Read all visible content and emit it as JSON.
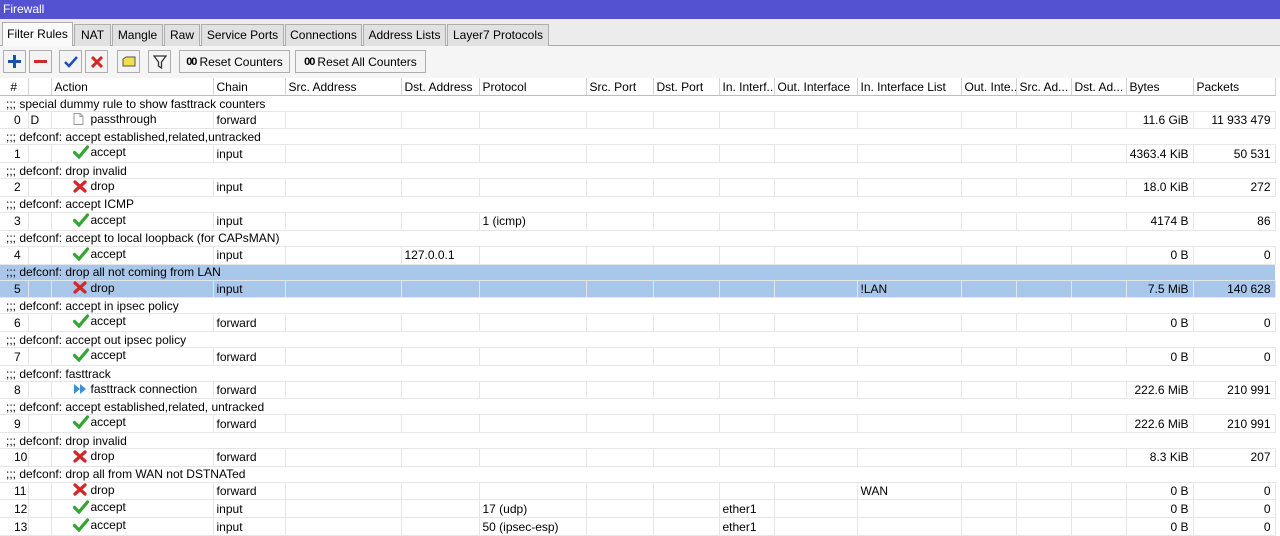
{
  "window": {
    "title": "Firewall"
  },
  "tabs": [
    "Filter Rules",
    "NAT",
    "Mangle",
    "Raw",
    "Service Ports",
    "Connections",
    "Address Lists",
    "Layer7 Protocols"
  ],
  "toolbar": {
    "reset_counters": "Reset Counters",
    "reset_all_counters": "Reset All Counters",
    "counter_glyph": "00"
  },
  "columns": [
    "#",
    "",
    "Action",
    "Chain",
    "Src. Address",
    "Dst. Address",
    "Protocol",
    "Src. Port",
    "Dst. Port",
    "In. Interf...",
    "Out. Interface",
    "In. Interface List",
    "Out. Inte...",
    "Src. Ad...",
    "Dst. Ad...",
    "Bytes",
    "Packets"
  ],
  "colors": {
    "accept": "#33a532",
    "drop": "#d42828",
    "fasttrack": "#3d8fd8",
    "selected": "#a8c7ea",
    "titlebar": "#5452d0"
  },
  "rows": [
    {
      "comment": ";;; special dummy rule to show fasttrack counters",
      "num": "0",
      "flag": "D",
      "action": "passthrough",
      "icon": "document-icon",
      "chain": "forward",
      "src": "",
      "dst": "",
      "protocol": "",
      "in_if": "",
      "in_list": "",
      "bytes": "11.6 GiB",
      "packets": "11 933 479",
      "selected": false
    },
    {
      "comment": ";;; defconf: accept established,related,untracked",
      "num": "1",
      "flag": "",
      "action": "accept",
      "icon": "check-icon",
      "chain": "input",
      "src": "",
      "dst": "",
      "protocol": "",
      "in_if": "",
      "in_list": "",
      "bytes": "4363.4 KiB",
      "packets": "50 531",
      "selected": false
    },
    {
      "comment": ";;; defconf: drop invalid",
      "num": "2",
      "flag": "",
      "action": "drop",
      "icon": "x-icon",
      "chain": "input",
      "src": "",
      "dst": "",
      "protocol": "",
      "in_if": "",
      "in_list": "",
      "bytes": "18.0 KiB",
      "packets": "272",
      "selected": false
    },
    {
      "comment": ";;; defconf: accept ICMP",
      "num": "3",
      "flag": "",
      "action": "accept",
      "icon": "check-icon",
      "chain": "input",
      "src": "",
      "dst": "",
      "protocol": "1 (icmp)",
      "in_if": "",
      "in_list": "",
      "bytes": "4174 B",
      "packets": "86",
      "selected": false
    },
    {
      "comment": ";;; defconf: accept to local loopback (for CAPsMAN)",
      "num": "4",
      "flag": "",
      "action": "accept",
      "icon": "check-icon",
      "chain": "input",
      "src": "",
      "dst": "127.0.0.1",
      "protocol": "",
      "in_if": "",
      "in_list": "",
      "bytes": "0 B",
      "packets": "0",
      "selected": false
    },
    {
      "comment": ";;; defconf: drop all not coming from LAN",
      "num": "5",
      "flag": "",
      "action": "drop",
      "icon": "x-icon",
      "chain": "input",
      "src": "",
      "dst": "",
      "protocol": "",
      "in_if": "",
      "in_list": "!LAN",
      "bytes": "7.5 MiB",
      "packets": "140 628",
      "selected": true
    },
    {
      "comment": ";;; defconf: accept in ipsec policy",
      "num": "6",
      "flag": "",
      "action": "accept",
      "icon": "check-icon",
      "chain": "forward",
      "src": "",
      "dst": "",
      "protocol": "",
      "in_if": "",
      "in_list": "",
      "bytes": "0 B",
      "packets": "0",
      "selected": false
    },
    {
      "comment": ";;; defconf: accept out ipsec policy",
      "num": "7",
      "flag": "",
      "action": "accept",
      "icon": "check-icon",
      "chain": "forward",
      "src": "",
      "dst": "",
      "protocol": "",
      "in_if": "",
      "in_list": "",
      "bytes": "0 B",
      "packets": "0",
      "selected": false
    },
    {
      "comment": ";;; defconf: fasttrack",
      "num": "8",
      "flag": "",
      "action": "fasttrack connection",
      "icon": "fast-forward-icon",
      "chain": "forward",
      "src": "",
      "dst": "",
      "protocol": "",
      "in_if": "",
      "in_list": "",
      "bytes": "222.6 MiB",
      "packets": "210 991",
      "selected": false
    },
    {
      "comment": ";;; defconf: accept established,related, untracked",
      "num": "9",
      "flag": "",
      "action": "accept",
      "icon": "check-icon",
      "chain": "forward",
      "src": "",
      "dst": "",
      "protocol": "",
      "in_if": "",
      "in_list": "",
      "bytes": "222.6 MiB",
      "packets": "210 991",
      "selected": false
    },
    {
      "comment": ";;; defconf: drop invalid",
      "num": "10",
      "flag": "",
      "action": "drop",
      "icon": "x-icon",
      "chain": "forward",
      "src": "",
      "dst": "",
      "protocol": "",
      "in_if": "",
      "in_list": "",
      "bytes": "8.3 KiB",
      "packets": "207",
      "selected": false
    },
    {
      "comment": ";;; defconf: drop all from WAN not DSTNATed",
      "num": "11",
      "flag": "",
      "action": "drop",
      "icon": "x-icon",
      "chain": "forward",
      "src": "",
      "dst": "",
      "protocol": "",
      "in_if": "",
      "in_list": "WAN",
      "bytes": "0 B",
      "packets": "0",
      "selected": false
    },
    {
      "comment": "",
      "num": "12",
      "flag": "",
      "action": "accept",
      "icon": "check-icon",
      "chain": "input",
      "src": "",
      "dst": "",
      "protocol": "17 (udp)",
      "in_if": "ether1",
      "in_list": "",
      "bytes": "0 B",
      "packets": "0",
      "selected": false
    },
    {
      "comment": "",
      "num": "13",
      "flag": "",
      "action": "accept",
      "icon": "check-icon",
      "chain": "input",
      "src": "",
      "dst": "",
      "protocol": "50 (ipsec-esp)",
      "in_if": "ether1",
      "in_list": "",
      "bytes": "0 B",
      "packets": "0",
      "selected": false
    }
  ]
}
